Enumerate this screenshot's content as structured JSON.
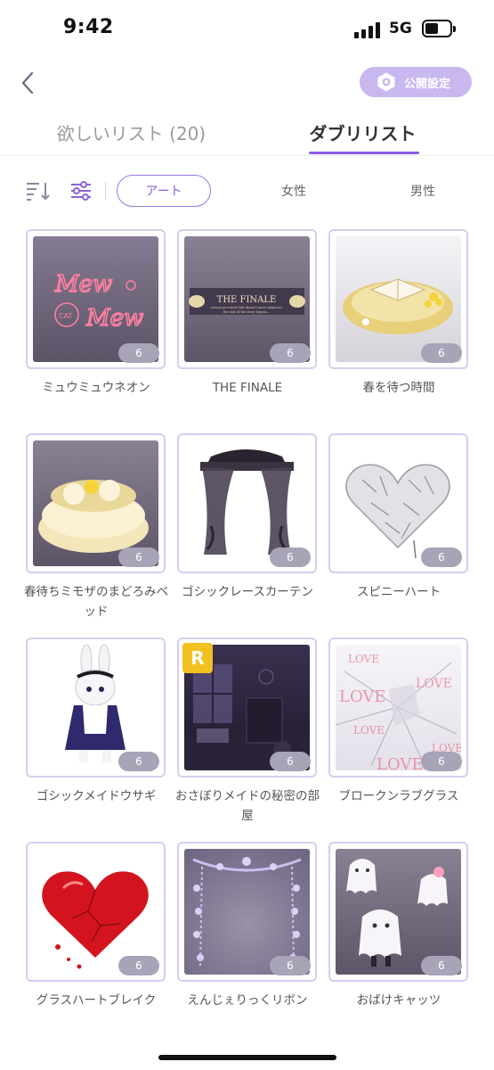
{
  "status": {
    "time": "9:42",
    "network": "5G"
  },
  "header": {
    "privacy_label": "公開設定"
  },
  "tabs": [
    {
      "label": "欲しいリスト (20)"
    },
    {
      "label": "ダブリリスト"
    }
  ],
  "filters": {
    "art": "アート",
    "female": "女性",
    "male": "男性"
  },
  "items": [
    {
      "name": "ミュウミュウネオン",
      "count": "6",
      "neon_top": "Mew",
      "neon_bottom": "Mew",
      "neon_badge": "CAT"
    },
    {
      "name": "THE FINALE",
      "count": "6",
      "banner_title": "THE FINALE",
      "banner_line1": "merry-go-round that doesn't move anymore",
      "banner_line2": "the end of the story begins..."
    },
    {
      "name": "春を待つ時間",
      "count": "6"
    },
    {
      "name": "春待ちミモザのまどろみベッド",
      "count": "6"
    },
    {
      "name": "ゴシックレースカーテン",
      "count": "6"
    },
    {
      "name": "スピニーハート",
      "count": "6"
    },
    {
      "name": "ゴシックメイドウサギ",
      "count": "6"
    },
    {
      "name": "おさぼりメイドの秘密の部屋",
      "count": "6",
      "rarity": "R"
    },
    {
      "name": "ブロークンラブグラス",
      "count": "6",
      "overlay_word": "LOVE"
    },
    {
      "name": "グラスハートブレイク",
      "count": "6"
    },
    {
      "name": "えんじぇりっくリボン",
      "count": "6"
    },
    {
      "name": "おばけキャッツ",
      "count": "6"
    }
  ]
}
